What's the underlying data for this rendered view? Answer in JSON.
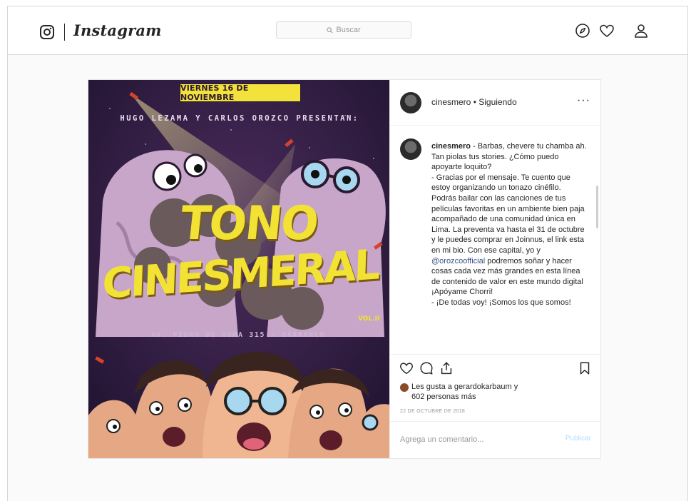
{
  "header": {
    "logo_text": "Instagram",
    "search_placeholder": "Buscar",
    "icons": [
      "instagram-glyph-icon",
      "compass-icon",
      "heart-icon",
      "user-icon"
    ]
  },
  "poster": {
    "date_banner": "VIERNES 16 DE NOVIEMBRE",
    "presenters": "HUGO LEZAMA Y CARLOS OROZCO PRESENTAN:",
    "title_line1": "TONO",
    "title_line2": "CINESMERAL",
    "volume": "VOL.II",
    "address": "AV. PEDRO DE OSMA 315 - BARRANCO",
    "colors": {
      "background": "#2e1a4a",
      "banner": "#f4e23c",
      "title": "#f2e233",
      "skin": "#c7a6c9",
      "smoke": "#6a5a5c"
    }
  },
  "post": {
    "username": "cinesmero",
    "follow_status": "• Siguiendo",
    "more_label": "···",
    "caption_user": "cinesmero",
    "caption_part1": " - Barbas, chevere tu chamba ah. Tan piolas tus stories. ¿Cómo puedo apoyarte loquito?\n- Gracias por el mensaje. Te cuento que estoy organizando un tonazo cinéfilo. Podrás bailar con las canciones de tus películas favoritas en un ambiente bien paja acompañado de una comunidad única en Lima. La preventa va hasta el 31 de octubre y le puedes comprar en Joinnus, el link esta en mi bio. Con ese capital, yo y ",
    "caption_mention": "@orozcoofficial",
    "caption_part2": " podremos soñar y hacer cosas cada vez más grandes en esta línea de contenido de valor en este mundo digital ¡Apóyame Chorri!\n- ¡De todas voy! ¡Somos los que somos!",
    "likes_line1": "Les gusta a gerardokarbaum y",
    "likes_line2": "602 personas más",
    "date": "22 DE OCTUBRE DE 2018",
    "comment_placeholder": "Agrega un comentario...",
    "publish_label": "Publicar",
    "colors": {
      "link": "#385185",
      "publish_disabled": "#b3dbff"
    }
  }
}
